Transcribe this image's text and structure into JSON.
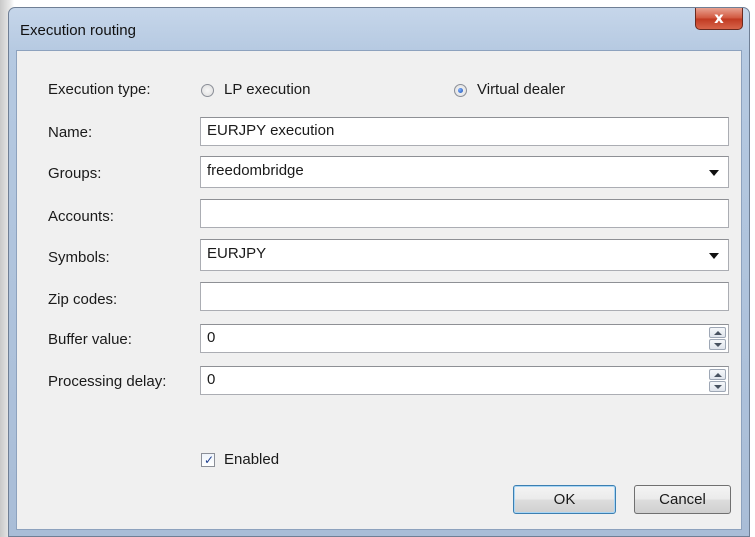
{
  "window": {
    "title": "Execution routing",
    "close_glyph": "x"
  },
  "form": {
    "execution_type_label": "Execution type:",
    "options": [
      {
        "label": "LP execution",
        "checked": false
      },
      {
        "label": "Virtual dealer",
        "checked": true
      }
    ],
    "name_label": "Name:",
    "name_value": "EURJPY execution",
    "groups_label": "Groups:",
    "groups_value": "freedombridge",
    "accounts_label": "Accounts:",
    "accounts_value": "",
    "symbols_label": "Symbols:",
    "symbols_value": "EURJPY",
    "zip_label": "Zip codes:",
    "zip_value": "",
    "buffer_label": "Buffer value:",
    "buffer_value": "0",
    "delay_label": "Processing delay:",
    "delay_value": "0",
    "enabled_label": "Enabled",
    "enabled_checked": true,
    "check_glyph": "✓"
  },
  "buttons": {
    "ok": "OK",
    "cancel": "Cancel"
  },
  "icons": {
    "close": "close-icon",
    "dropdown": "chevron-down-icon",
    "spin_up": "arrow-up-icon",
    "spin_down": "arrow-down-icon"
  },
  "colors": {
    "title_bar": "#b9cce4",
    "client_bg": "#f0f0f0",
    "close_button": "#c94a30",
    "default_button_border": "#3c7fb1"
  }
}
